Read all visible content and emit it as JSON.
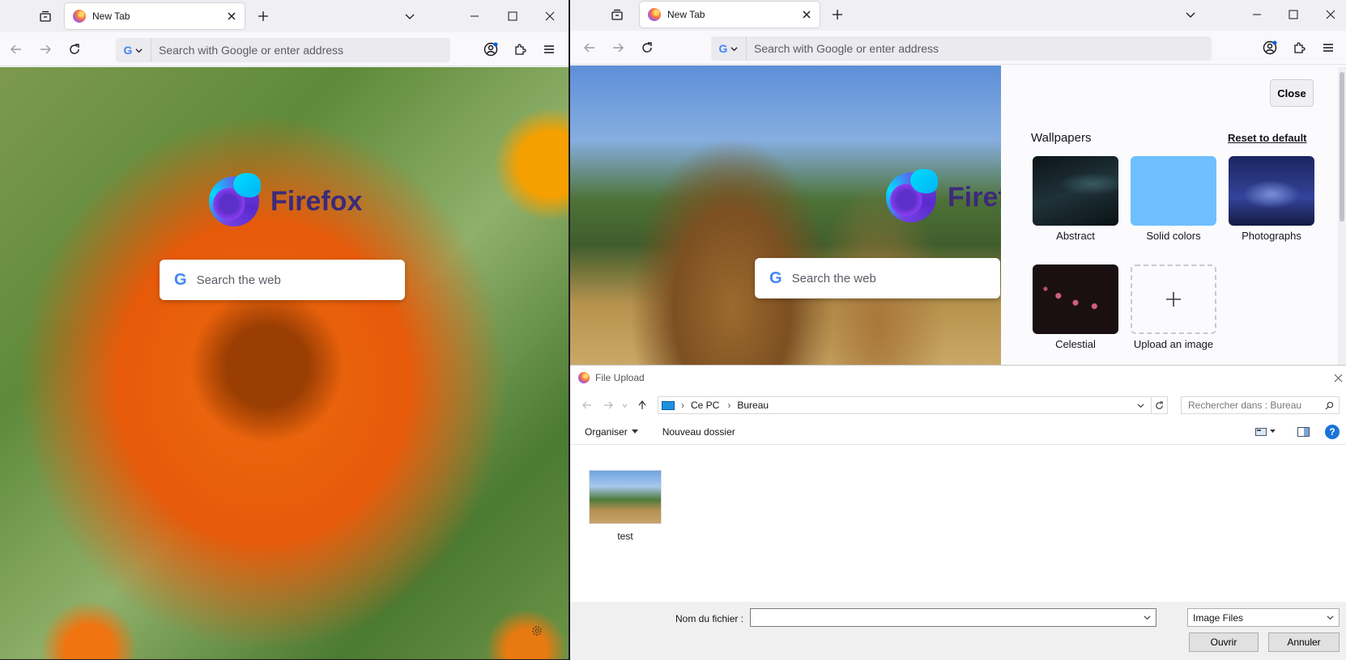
{
  "left_window": {
    "tab_title": "New Tab",
    "url_placeholder": "Search with Google or enter address",
    "search_engine_letter": "G",
    "brand_name": "Firefox",
    "web_search_placeholder": "Search the web",
    "wallpaper": "orange-flower"
  },
  "right_window": {
    "tab_title": "New Tab",
    "url_placeholder": "Search with Google or enter address",
    "search_engine_letter": "G",
    "brand_name": "Firefox",
    "web_search_placeholder": "Search the web",
    "wallpaper": "giraffes",
    "customize": {
      "close_label": "Close",
      "section_title": "Wallpapers",
      "reset_label": "Reset to default",
      "categories": [
        {
          "label": "Abstract",
          "color": "#0f1c22"
        },
        {
          "label": "Solid colors",
          "color": "#6ec0ff"
        },
        {
          "label": "Photographs",
          "color": "#2a3878"
        },
        {
          "label": "Celestial",
          "color": "#1a1012"
        },
        {
          "label": "Upload an image",
          "icon": "plus-icon"
        }
      ]
    }
  },
  "file_dialog": {
    "title": "File Upload",
    "path": [
      "Ce PC",
      "Bureau"
    ],
    "search_placeholder": "Rechercher dans : Bureau",
    "organise_label": "Organiser",
    "new_folder_label": "Nouveau dossier",
    "files": [
      {
        "name": "test"
      }
    ],
    "filename_label": "Nom du fichier :",
    "filename_value": "",
    "filetype": "Image Files",
    "open_label": "Ouvrir",
    "cancel_label": "Annuler"
  }
}
